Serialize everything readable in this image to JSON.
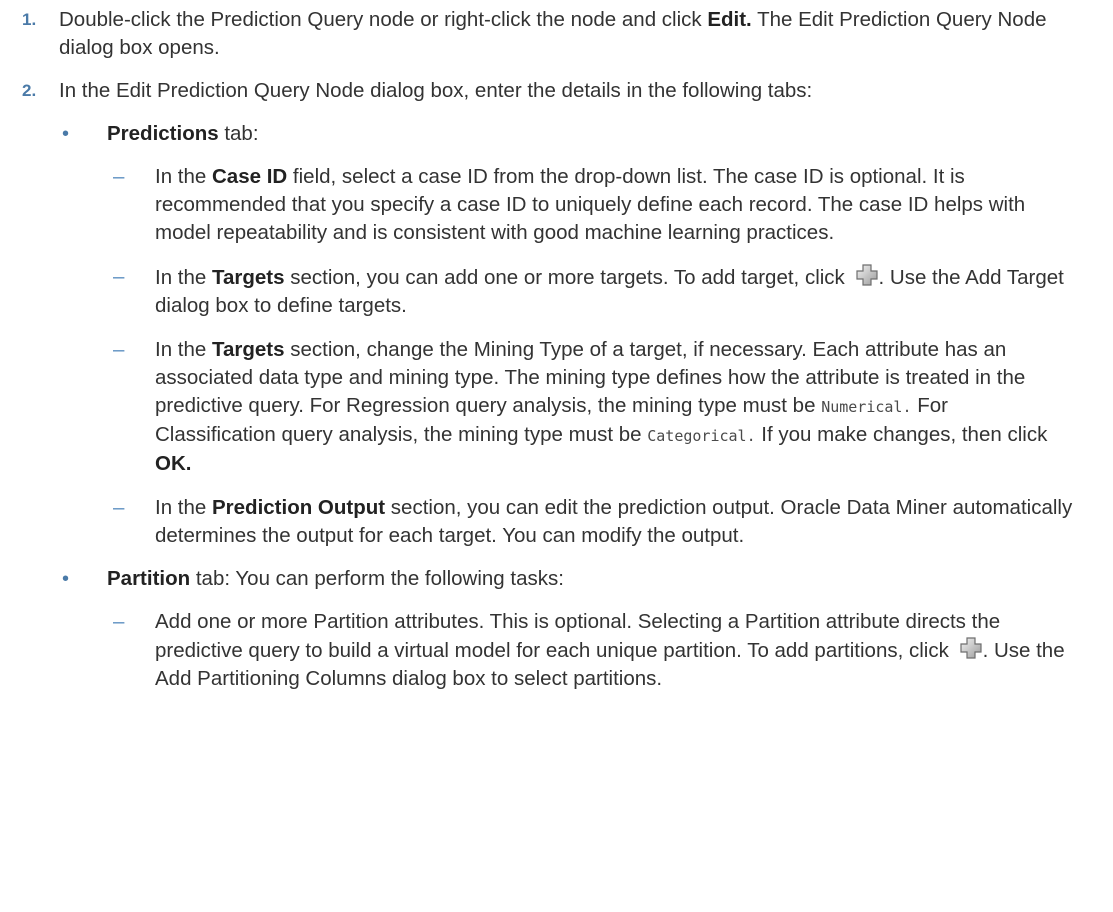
{
  "steps": [
    {
      "number": "1.",
      "t1": "Double-click the Prediction Query node or right-click the node and click ",
      "b1": "Edit.",
      "t2": " The Edit Prediction Query Node dialog box opens."
    },
    {
      "number": "2.",
      "text": "In the Edit Prediction Query Node dialog box, enter the details in the following tabs:"
    }
  ],
  "predictions": {
    "bullet": "•",
    "label": "Predictions",
    "suffix": " tab:",
    "items": [
      {
        "t1": "In the ",
        "b1": "Case ID",
        "t2": " field, select a case ID from the drop-down list. The case ID is optional. It is recommended that you specify a case ID to uniquely define each record. The case ID helps with model repeatability and is consistent with good machine learning practices."
      },
      {
        "t1": "In the ",
        "b1": "Targets",
        "t2": " section, you can add one or more targets. To add target, click ",
        "t3": ". Use the Add Target dialog box to define targets."
      },
      {
        "t1": "In the ",
        "b1": "Targets",
        "t2": " section, change the Mining Type of a target, if necessary. Each attribute has an associated data type and mining type. The mining type defines how the attribute is treated in the predictive query. For Regression query analysis, the mining type must be ",
        "code1": "Numerical.",
        "t3": "  For Classification query analysis, the mining type must be ",
        "code2": "Categorical.",
        "t4": " If you make changes, then click ",
        "b2": "OK."
      },
      {
        "t1": "In the ",
        "b1": "Prediction Output",
        "t2": " section, you can edit the prediction output. Oracle Data Miner automatically determines the output for each target. You can modify the output."
      }
    ]
  },
  "partition": {
    "bullet": "•",
    "label": "Partition",
    "suffix": " tab: You can perform the following tasks:",
    "items": [
      {
        "t1": "Add one or more Partition attributes. This is optional. Selecting a Partition attribute directs the predictive query to build a virtual model for each unique partition. To add partitions, click ",
        "t2": ". Use the Add Partitioning Columns dialog box to select partitions."
      }
    ]
  },
  "dash": "–",
  "icons": {
    "add": "add-plus-icon"
  }
}
